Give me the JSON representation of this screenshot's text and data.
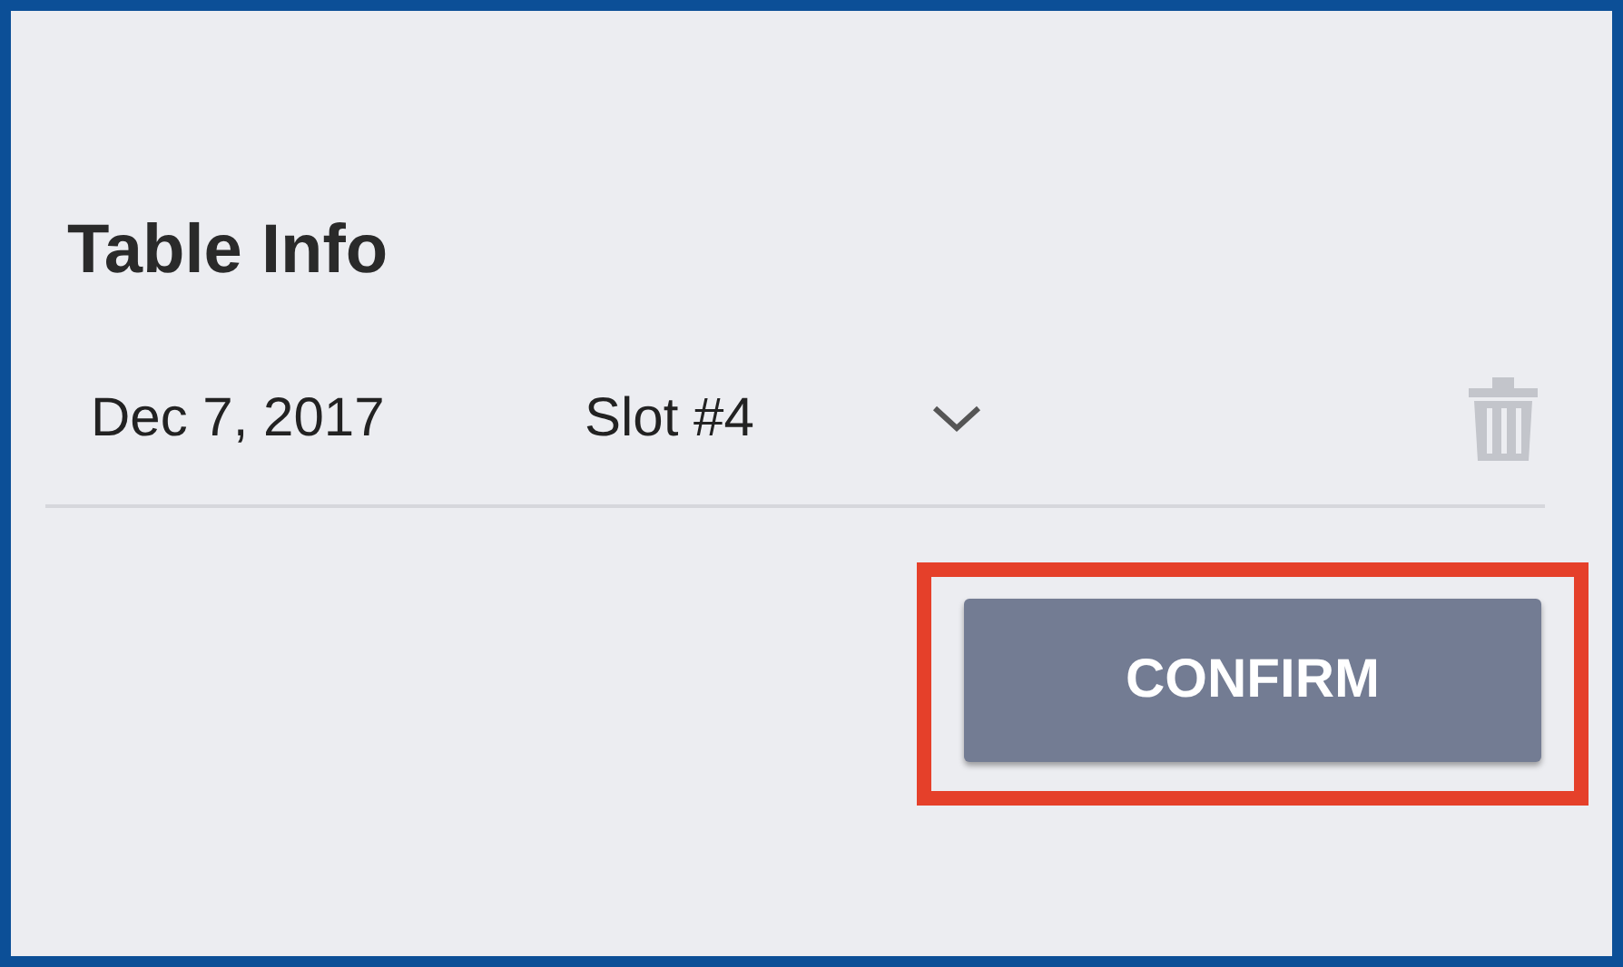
{
  "title": "Table Info",
  "entry": {
    "date": "Dec 7, 2017",
    "slot": "Slot #4"
  },
  "confirm_button": {
    "label": "CONFIRM",
    "highlighted": true
  }
}
